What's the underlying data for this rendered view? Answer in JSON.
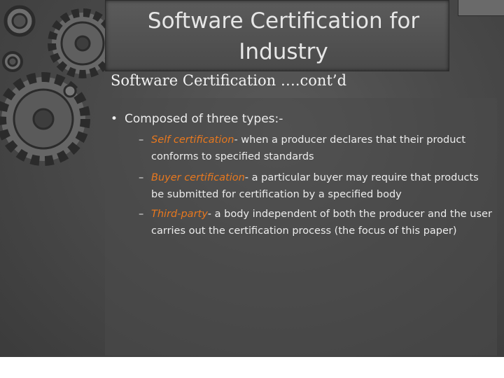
{
  "slide": {
    "title": "Software Certification for\nIndustry",
    "subtitle": "Software Certification ….cont’d",
    "bullet": "Composed of three types:-",
    "sub_items": [
      {
        "term": "Self certification",
        "rest": "- when a producer declares that their product conforms to specified standards"
      },
      {
        "term": "Buyer certification",
        "rest": "- a particular buyer may require that products be submitted for certification by a specified body"
      },
      {
        "term": "Third-party",
        "rest": "- a body independent of both the producer and the user carries out the certification process (the focus of this paper)"
      }
    ]
  },
  "colors": {
    "accent": "#e8781e",
    "background": "#4a4a4a",
    "text": "#ececec"
  }
}
